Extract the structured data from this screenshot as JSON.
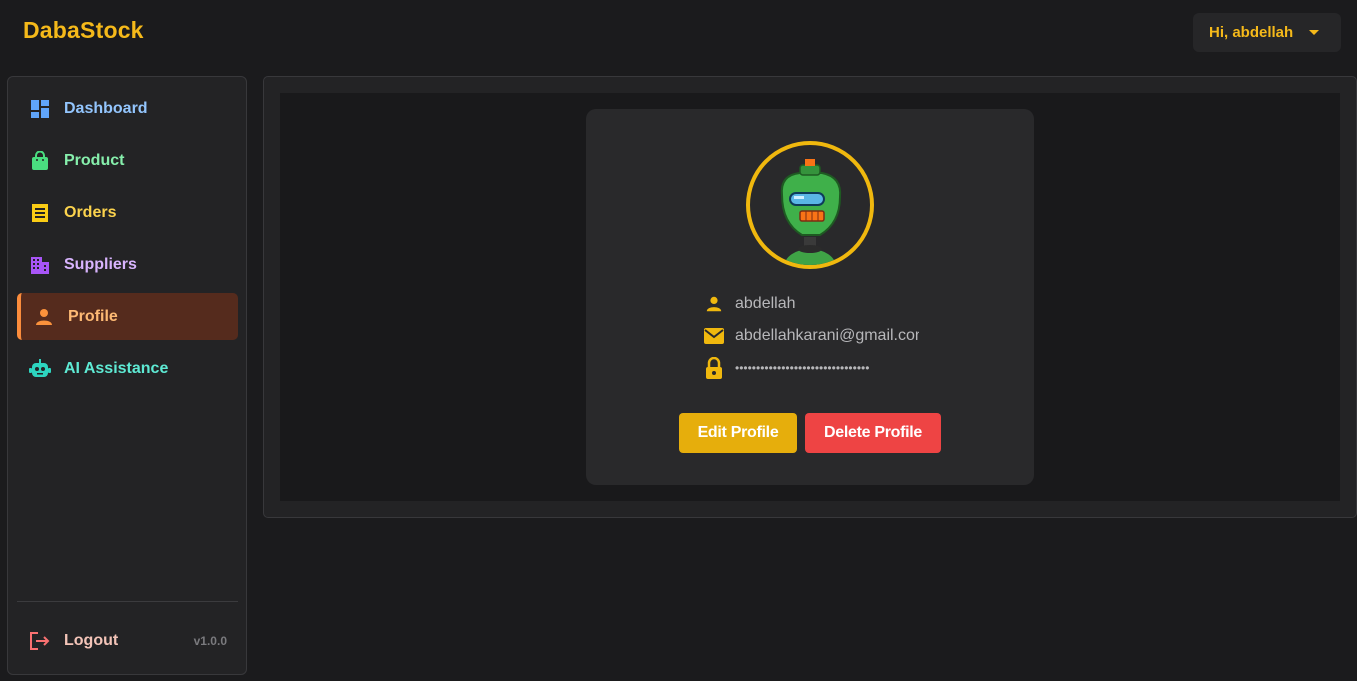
{
  "app": {
    "title": "DabaStock"
  },
  "header": {
    "greeting": "Hi, abdellah"
  },
  "sidebar": {
    "items": [
      {
        "label": "Dashboard",
        "icon": "dashboard-icon",
        "color": "#93c5fd"
      },
      {
        "label": "Product",
        "icon": "shopping-bag-icon",
        "color": "#86efac"
      },
      {
        "label": "Orders",
        "icon": "receipt-icon",
        "color": "#fcd34d"
      },
      {
        "label": "Suppliers",
        "icon": "building-icon",
        "color": "#d8b4fe"
      },
      {
        "label": "Profile",
        "icon": "person-icon",
        "color": "#fdba74",
        "active": true
      },
      {
        "label": "AI Assistance",
        "icon": "robot-icon",
        "color": "#5eead4"
      }
    ],
    "logout_label": "Logout",
    "version": "v1.0.0"
  },
  "profile": {
    "username": "abdellah",
    "email": "abdellahkarani@gmail.com",
    "password_mask": "••••••••••••••••••••••••••••••••",
    "edit_label": "Edit Profile",
    "delete_label": "Delete Profile"
  },
  "colors": {
    "accent": "#f5b91a",
    "active_bg": "#552b1d",
    "active_border": "#fb8c3c",
    "danger": "#ee4444",
    "edit": "#e6ae0c"
  }
}
